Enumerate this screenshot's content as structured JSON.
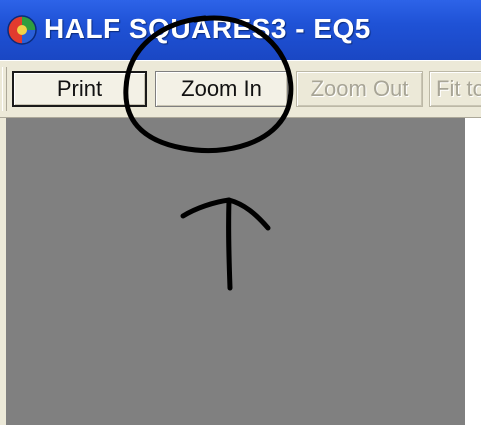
{
  "window": {
    "title": "HALF SQUARES3 - EQ5",
    "app_icon": "eq5-app-icon"
  },
  "toolbar": {
    "buttons": [
      {
        "label": "Print",
        "enabled": true,
        "default": true
      },
      {
        "label": "Zoom In",
        "enabled": true,
        "default": false
      },
      {
        "label": "Zoom Out",
        "enabled": false,
        "default": false
      },
      {
        "label": "Fit to",
        "enabled": false,
        "default": false
      }
    ]
  },
  "annotation": {
    "shapes": [
      "hand-drawn-circle",
      "hand-drawn-arrow-up"
    ],
    "ink_color": "#000000"
  },
  "colors": {
    "titlebar": "#1f52d6",
    "toolbar": "#ece9d8",
    "canvas": "#808080"
  }
}
